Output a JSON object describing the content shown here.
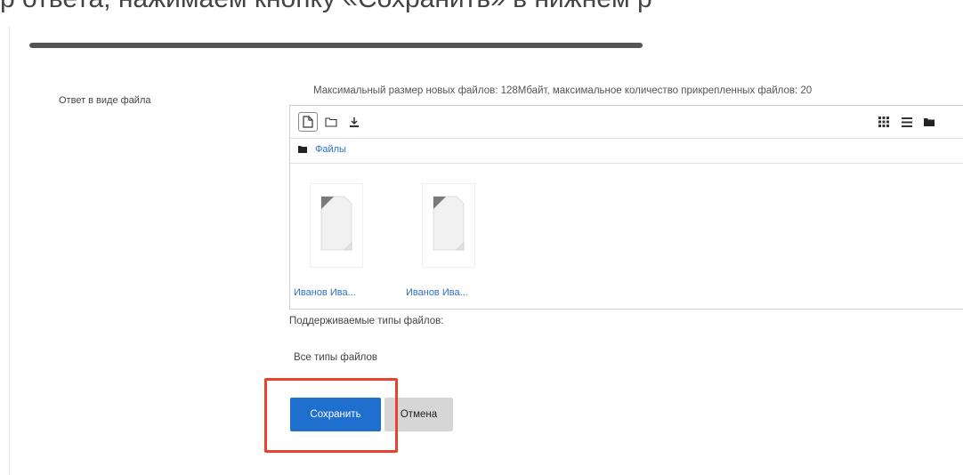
{
  "header_fragment": "р ответа, нажимаем кнопку «Сохранить» в нижнем р",
  "upload_progress": 1.0,
  "form": {
    "field_label": "Ответ в виде файла",
    "max_size_note": "Максимальный размер новых файлов: 128Мбайт, максимальное количество прикрепленных файлов: 20"
  },
  "filemanager": {
    "toolbar": {
      "add_file_icon": "file-add-icon",
      "create_folder_icon": "folder-add-icon",
      "download_icon": "download-icon"
    },
    "view_icons": [
      "grid-view-icon",
      "list-view-icon",
      "tree-view-icon"
    ],
    "path_label": "Файлы",
    "files": [
      {
        "name": "Иванов Ива..."
      },
      {
        "name": "Иванов Ива..."
      }
    ]
  },
  "supported_types_label": "Поддерживаемые типы файлов:",
  "supported_types_value": "Все типы файлов",
  "buttons": {
    "save": "Сохранить",
    "cancel": "Отмена"
  },
  "colors": {
    "primary": "#1f6fcf",
    "link": "#2e6fc4",
    "highlight": "#e8432f"
  }
}
